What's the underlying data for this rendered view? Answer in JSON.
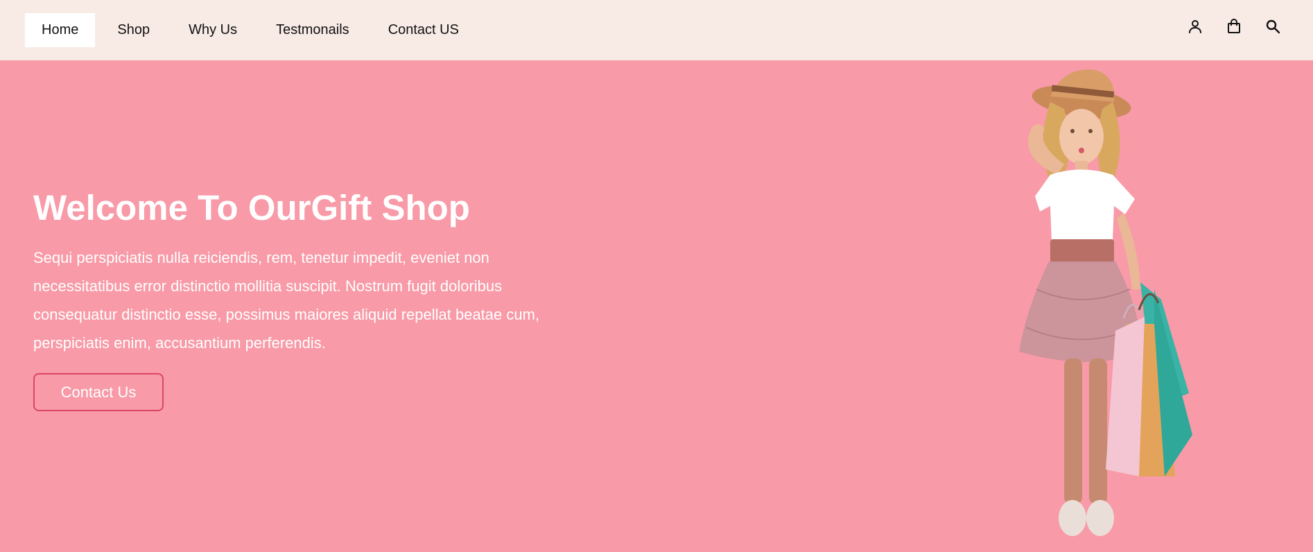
{
  "nav": {
    "items": [
      {
        "label": "Home",
        "active": true
      },
      {
        "label": "Shop"
      },
      {
        "label": "Why Us"
      },
      {
        "label": "Testmonails"
      },
      {
        "label": "Contact US"
      }
    ],
    "icons": [
      "user-icon",
      "shopping-bag-icon",
      "search-icon"
    ]
  },
  "hero": {
    "title": "Welcome To OurGift Shop",
    "text": "Sequi perspiciatis nulla reiciendis, rem, tenetur impedit, eveniet non necessitatibus error distinctio mollitia suscipit. Nostrum fugit doloribus consequatur distinctio esse, possimus maiores aliquid repellat beatae cum, perspiciatis enim, accusantium perferendis.",
    "button_label": "Contact Us"
  },
  "colors": {
    "nav_bg": "#f8ebe6",
    "hero_bg": "#f89aa7",
    "button_border": "#d9466a"
  }
}
